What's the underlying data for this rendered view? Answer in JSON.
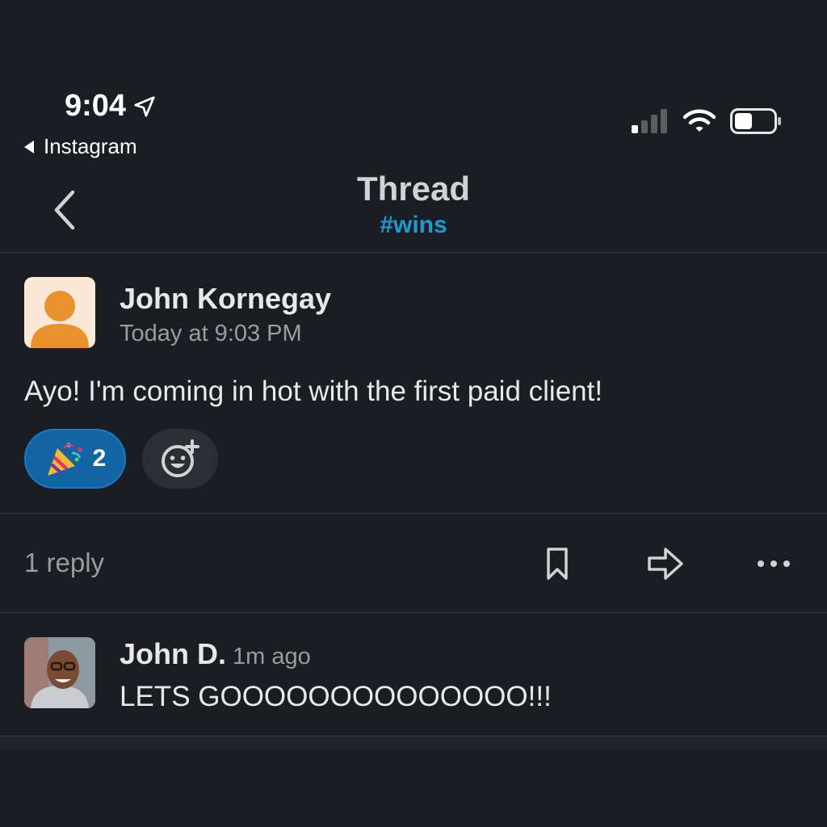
{
  "status_bar": {
    "time": "9:04",
    "back_app": "Instagram"
  },
  "header": {
    "title": "Thread",
    "channel": "#wins"
  },
  "message": {
    "author": "John Kornegay",
    "timestamp": "Today at 9:03 PM",
    "text": "Ayo! I'm coming in hot with the first paid client!",
    "reaction": {
      "emoji": "🎉",
      "count": "2"
    }
  },
  "actions": {
    "reply_count": "1 reply"
  },
  "reply": {
    "author": "John D.",
    "time": "1m ago",
    "text": "LETS GOOOOOOOOOOOOOO!!!"
  },
  "colors": {
    "background": "#1a1d21",
    "channel_link": "#1d9bd1",
    "reaction_bg": "#1264a3"
  }
}
